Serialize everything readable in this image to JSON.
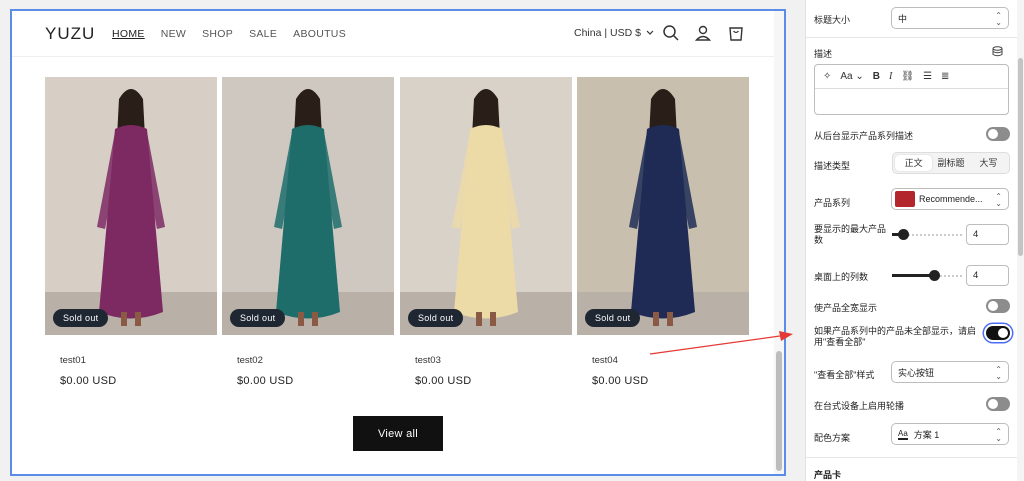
{
  "store": {
    "logo": "YUZU",
    "nav": [
      "HOME",
      "NEW",
      "SHOP",
      "SALE",
      "ABOUTUS"
    ],
    "active_nav": "HOME",
    "locale": "China | USD $",
    "icons": [
      "search-icon",
      "account-icon",
      "cart-icon"
    ]
  },
  "products": [
    {
      "name": "test01",
      "price": "$0.00 USD",
      "badge": "Sold out",
      "dress_color": "#7d2a63",
      "bg": "#d7cfc6"
    },
    {
      "name": "test02",
      "price": "$0.00 USD",
      "badge": "Sold out",
      "dress_color": "#1f6d6b",
      "bg": "#cfc8c1"
    },
    {
      "name": "test03",
      "price": "$0.00 USD",
      "badge": "Sold out",
      "dress_color": "#ecdba7",
      "bg": "#d9d2c9"
    },
    {
      "name": "test04",
      "price": "$0.00 USD",
      "badge": "Sold out",
      "dress_color": "#1f2b55",
      "bg": "#c9bfae"
    }
  ],
  "view_all_label": "View all",
  "settings": {
    "heading_size_label": "标题大小",
    "heading_size_value": "中",
    "description_label": "描述",
    "show_collection_desc_label": "从后台显示产品系列描述",
    "desc_style_label": "描述类型",
    "desc_style_options": [
      "正文",
      "副标题",
      "大写"
    ],
    "desc_style_active": "正文",
    "collection_label": "产品系列",
    "collection_value": "Recommende...",
    "max_products_label": "要显示的最大产品数",
    "max_products_value": "4",
    "max_products_fraction": 0.1,
    "columns_desktop_label": "桌面上的列数",
    "columns_desktop_value": "4",
    "columns_desktop_fraction": 0.6,
    "full_width_label": "使产品全宽显示",
    "view_all_toggle_label": "如果产品系列中的产品未全部显示，请启用\"查看全部\"",
    "view_all_style_label": "\"查看全部\"样式",
    "view_all_style_value": "实心按钮",
    "carousel_label": "在台式设备上启用轮播",
    "color_scheme_label": "配色方案",
    "color_scheme_value": "方案 1",
    "product_card_heading": "产品卡"
  },
  "colors": {
    "frame_border": "#5b8de8",
    "annotation_arrow": "#e53935",
    "badge_bg": "#1f2733"
  }
}
